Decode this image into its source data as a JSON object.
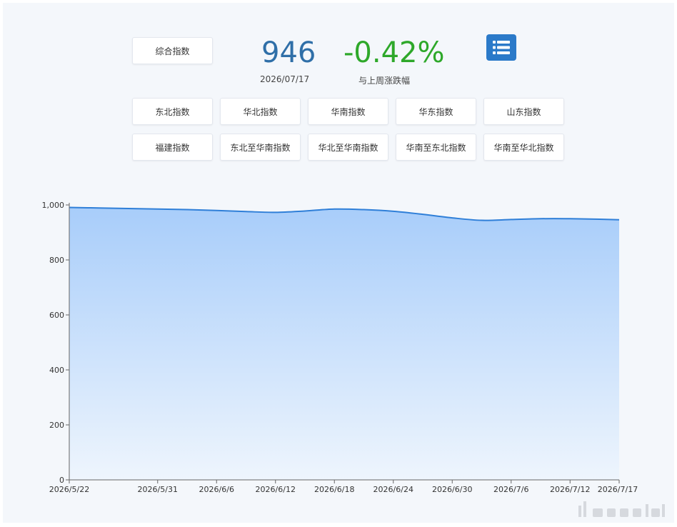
{
  "header": {
    "composite_button": "综合指数",
    "value": "946",
    "date": "2026/07/17",
    "change": "-0.42%",
    "change_label": "与上周涨跌幅",
    "value_color": "#2f6fa8",
    "change_color": "#2ea82a",
    "menu_icon": "list-icon"
  },
  "index_buttons": [
    [
      "东北指数",
      "华北指数",
      "华南指数",
      "华东指数",
      "山东指数"
    ],
    [
      "福建指数",
      "东北至华南指数",
      "华北至华南指数",
      "华南至东北指数",
      "华南至华北指数"
    ]
  ],
  "chart_data": {
    "type": "area",
    "x": [
      "2026/5/22",
      "2026/5/25",
      "2026/5/28",
      "2026/5/31",
      "2026/6/3",
      "2026/6/6",
      "2026/6/9",
      "2026/6/12",
      "2026/6/15",
      "2026/6/18",
      "2026/6/21",
      "2026/6/24",
      "2026/6/27",
      "2026/6/30",
      "2026/7/3",
      "2026/7/6",
      "2026/7/9",
      "2026/7/12",
      "2026/7/15",
      "2026/7/17"
    ],
    "x_tick_labels": [
      "2026/5/22",
      "2026/5/31",
      "2026/6/6",
      "2026/6/12",
      "2026/6/18",
      "2026/6/24",
      "2026/6/30",
      "2026/7/6",
      "2026/7/12",
      "2026/7/17"
    ],
    "series": [
      {
        "values": [
          991,
          989,
          987,
          985,
          983,
          980,
          976,
          973,
          978,
          985,
          983,
          977,
          966,
          953,
          944,
          947,
          950,
          950,
          948,
          946
        ]
      }
    ],
    "ylim": [
      0,
      1000
    ],
    "y_ticks": [
      0,
      200,
      400,
      600,
      800,
      1000
    ],
    "y_tick_labels": [
      "0",
      "200",
      "400",
      "600",
      "800",
      "1,000"
    ],
    "line_color": "#2f7fd8",
    "fill_top_color": "#a8cdfa",
    "fill_bottom_color": "#eef5fd",
    "grid": false
  }
}
